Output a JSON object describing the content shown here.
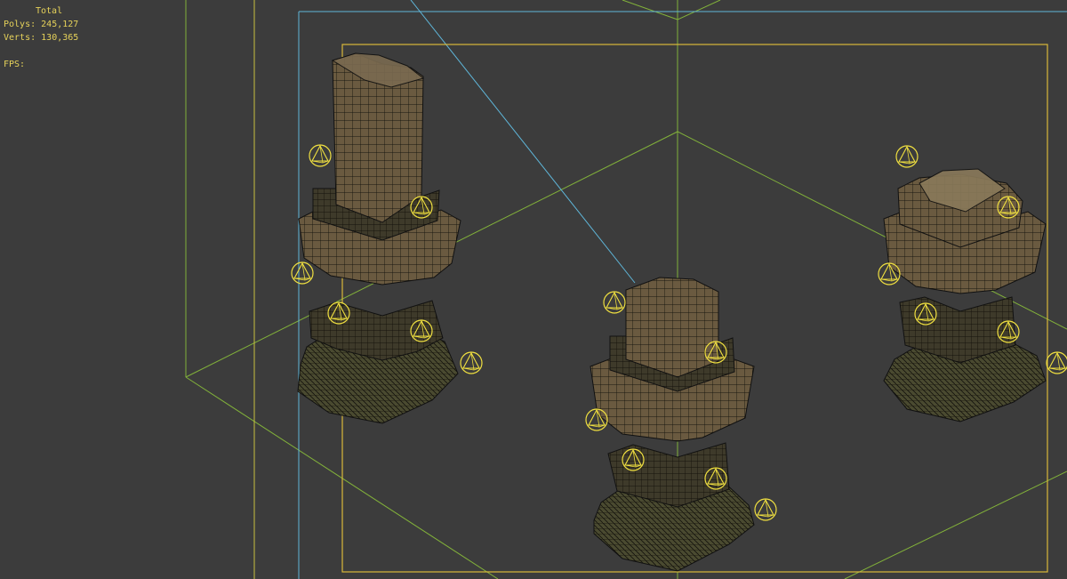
{
  "stats": {
    "total_label": "Total",
    "polys_label": "Polys:",
    "polys_value": "245,127",
    "verts_label": "Verts:",
    "verts_value": "130,365",
    "fps_label": "FPS:",
    "fps_value": ""
  },
  "colors": {
    "background": "#3c3c3c",
    "stats_text": "#e6d25a",
    "safe_frame_outer": "#c8c040",
    "safe_frame_inner": "#d8b83a",
    "camera_frustum": "#5fb6d9",
    "grid": "#8ec63a",
    "helper": "#f0e040",
    "stone": "#6e5c40",
    "wire": "#1a1a14"
  },
  "scene": {
    "objects": [
      "pillar-tall",
      "pillar-center",
      "pillar-right"
    ],
    "helper_icon": "octahedron-light-icon"
  }
}
